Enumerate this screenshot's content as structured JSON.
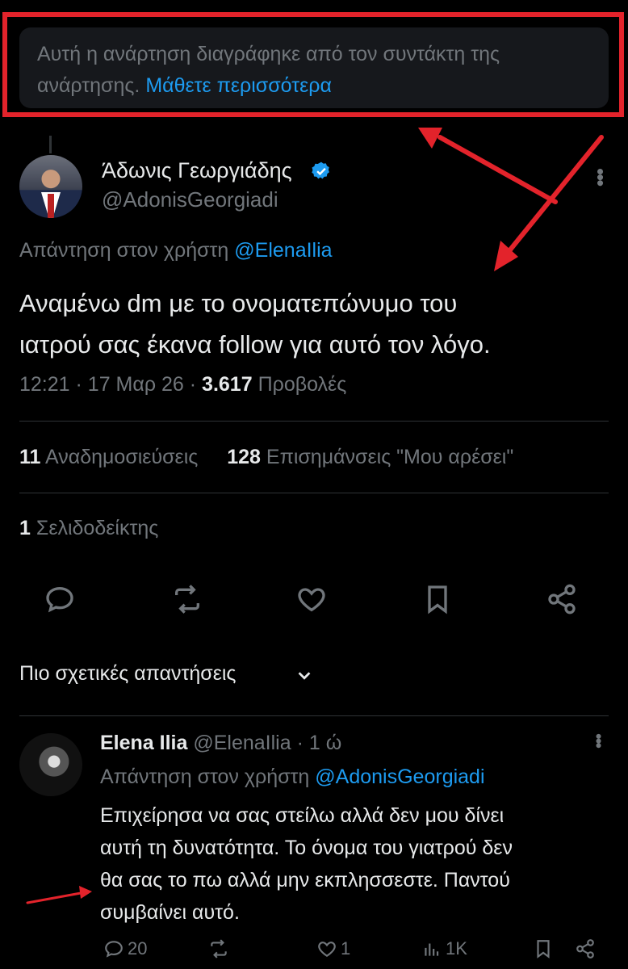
{
  "notice": {
    "text": "Αυτή η ανάρτηση διαγράφηκε από τον συντάκτη της ανάρτησης.",
    "link": "Μάθετε περισσότερα"
  },
  "post": {
    "author_name": "Άδωνις Γεωργιάδης",
    "author_handle": "@AdonisGeorgiadi",
    "reply_label": "Απάντηση στον χρήστη",
    "reply_to": "@ElenaIlia",
    "text_line1": "Αναμένω dm με το ονοματεπώνυμο του",
    "text_line2": "ιατρού σας έκανα follow για αυτό τον λόγο.",
    "time": "12:21",
    "date": "17 Μαρ 26",
    "views_count": "3.617",
    "views_label": "Προβολές",
    "reposts_count": "11",
    "reposts_label": "Αναδημοσιεύσεις",
    "likes_count": "128",
    "likes_label": "Επισημάνσεις \"Μου αρέσει\"",
    "bookmarks_count": "1",
    "bookmarks_label": "Σελιδοδείκτης"
  },
  "sort": {
    "label": "Πιο σχετικές απαντήσεις"
  },
  "reply": {
    "author_name": "Elena Ilia",
    "author_handle": "@ElenaIlia",
    "age": "1 ώ",
    "reply_label": "Απάντηση στον χρήστη",
    "reply_to": "@AdonisGeorgiadi",
    "line1": "Επιχείρησα να σας στείλω αλλά δεν μου δίνει",
    "line2": "αυτή τη δυνατότητα. Το όνομα του γιατρού δεν",
    "line3": "θα σας το πω αλλά μην εκπλησσεστε. Παντού",
    "line4": "συμβαίνει αυτό.",
    "replies": "20",
    "likes": "1",
    "views": "1K"
  },
  "colors": {
    "background": "#000000",
    "text": "#e7e9ea",
    "muted": "#71767b",
    "link": "#1d9bf0",
    "annotation_red": "#e3232b"
  },
  "icons": [
    "verified-badge-icon",
    "more-icon",
    "reply-icon",
    "repost-icon",
    "like-icon",
    "bookmark-icon",
    "share-icon",
    "chevron-down-icon",
    "views-icon"
  ]
}
